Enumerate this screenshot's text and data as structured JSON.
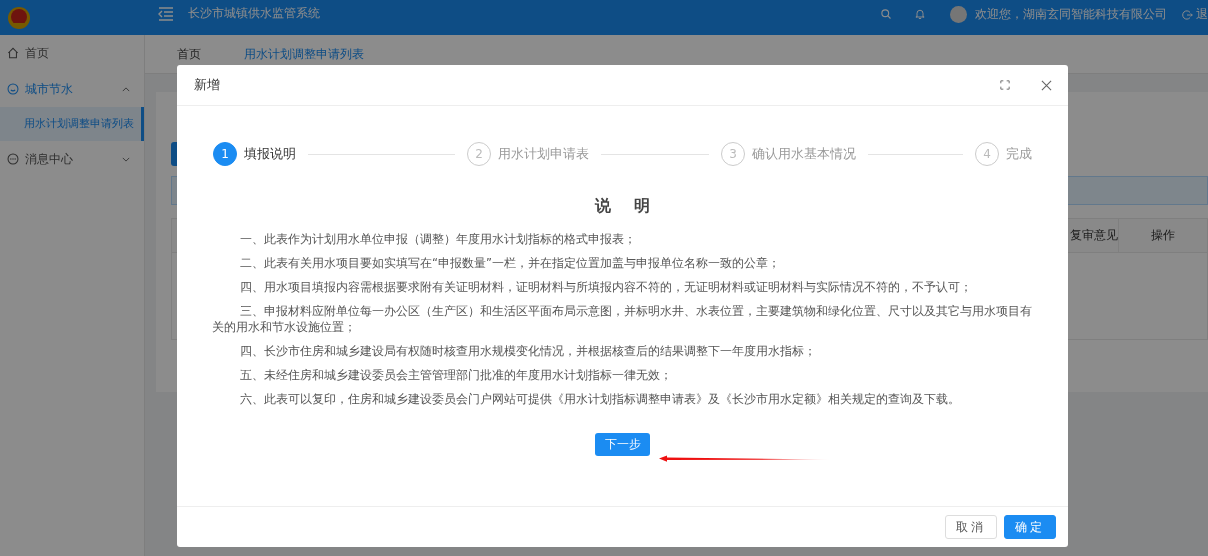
{
  "header": {
    "title": "长沙市城镇供水监管系统",
    "welcome": "欢迎您，湖南玄同智能科技有限公司",
    "logout": "退"
  },
  "sidebar": {
    "items": [
      {
        "label": "首页",
        "kind": "link",
        "selected": false
      },
      {
        "label": "城市节水",
        "kind": "submenu",
        "expanded": true,
        "selected": false,
        "children": [
          {
            "label": "用水计划调整申请列表",
            "selected": true
          }
        ]
      },
      {
        "label": "消息中心",
        "kind": "submenu",
        "expanded": false,
        "selected": false
      }
    ]
  },
  "tabs": [
    {
      "label": "首页",
      "selected": false
    },
    {
      "label": "用水计划调整申请列表",
      "selected": true
    }
  ],
  "content": {
    "table": {
      "columns": [
        "复审意见",
        "操作"
      ]
    }
  },
  "modal": {
    "title": "新增",
    "steps": [
      {
        "number": "1",
        "label": "填报说明",
        "selected": true
      },
      {
        "number": "2",
        "label": "用水计划申请表",
        "selected": false
      },
      {
        "number": "3",
        "label": "确认用水基本情况",
        "selected": false
      },
      {
        "number": "4",
        "label": "完成",
        "selected": false
      }
    ],
    "heading": "说 明",
    "paragraphs": [
      "一、此表作为计划用水单位申报（调整）年度用水计划指标的格式申报表；",
      "二、此表有关用水项目要如实填写在“申报数量”一栏，并在指定位置加盖与申报单位名称一致的公章；",
      "四、用水项目填报内容需根据要求附有关证明材料，证明材料与所填报内容不符的，无证明材料或证明材料与实际情况不符的，不予认可；",
      "三、申报材料应附单位每一办公区（生产区）和生活区平面布局示意图，并标明水井、水表位置，主要建筑物和绿化位置、尺寸以及其它与用水项目有关的用水和节水设施位置；",
      "四、长沙市住房和城乡建设局有权随时核查用水规模变化情况，并根据核查后的结果调整下一年度用水指标；",
      "五、未经住房和城乡建设委员会主管管理部门批准的年度用水计划指标一律无效；",
      "六、此表可以复印，住房和城乡建设委员会门户网站可提供《用水计划指标调整申请表》及《长沙市用水定额》相关规定的查询及下载。"
    ],
    "next_button": "下一步",
    "buttons": [
      {
        "label": "取消",
        "kind": "default"
      },
      {
        "label": "确定",
        "kind": "primary"
      }
    ]
  }
}
